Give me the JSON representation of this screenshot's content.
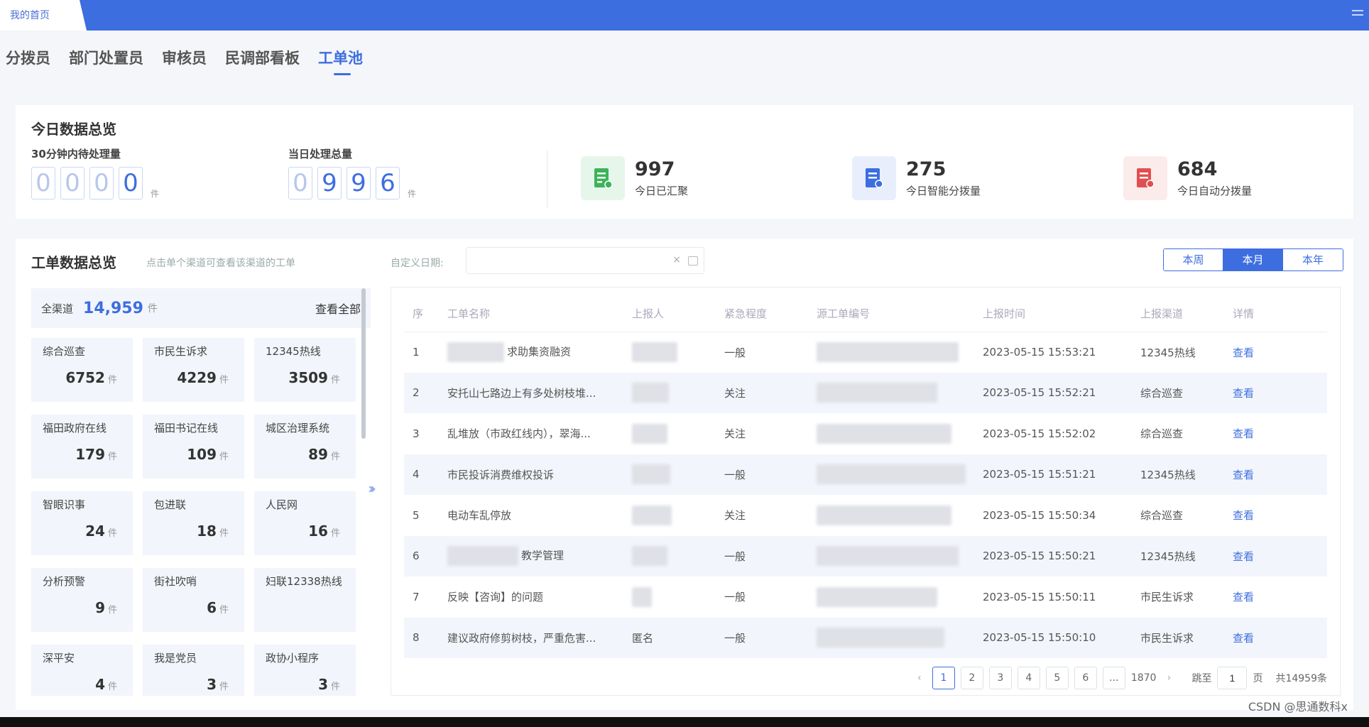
{
  "topbar": {
    "home_tab": "我的首页"
  },
  "role_tabs": [
    {
      "label": "分拨员"
    },
    {
      "label": "部门处置员"
    },
    {
      "label": "审核员"
    },
    {
      "label": "民调部看板"
    },
    {
      "label": "工单池",
      "active": true
    }
  ],
  "today": {
    "title": "今日数据总览",
    "pending30": {
      "label": "30分钟内待处理量",
      "digits": [
        "0",
        "0",
        "0",
        "0"
      ],
      "unit": "件"
    },
    "processed": {
      "label": "当日处理总量",
      "digits": [
        "0",
        "9",
        "9",
        "6"
      ],
      "unit": "件"
    },
    "stats": [
      {
        "value": "997",
        "label": "今日已汇聚",
        "color": "#3db35a",
        "bg": "#e7f6eb",
        "icon": "green-document-icon"
      },
      {
        "value": "275",
        "label": "今日智能分拨量",
        "color": "#3d6ee0",
        "bg": "#e8eefc",
        "icon": "blue-document-icon"
      },
      {
        "value": "684",
        "label": "今日自动分拨量",
        "color": "#e05050",
        "bg": "#fcebeb",
        "icon": "red-document-icon"
      }
    ]
  },
  "overview": {
    "title": "工单数据总览",
    "hint": "点击单个渠道可查看该渠道的工单",
    "date_label": "自定义日期:",
    "date_value": "",
    "clear_icon": "×",
    "periods": [
      {
        "label": "本周"
      },
      {
        "label": "本月",
        "active": true
      },
      {
        "label": "本年"
      }
    ],
    "all": {
      "label": "全渠道",
      "value": "14,959",
      "unit": "件",
      "link": "查看全部"
    },
    "channels": [
      {
        "name": "综合巡查",
        "value": "6752",
        "unit": "件"
      },
      {
        "name": "市民生诉求",
        "value": "4229",
        "unit": "件"
      },
      {
        "name": "12345热线",
        "value": "3509",
        "unit": "件"
      },
      {
        "name": "福田政府在线",
        "value": "179",
        "unit": "件"
      },
      {
        "name": "福田书记在线",
        "value": "109",
        "unit": "件"
      },
      {
        "name": "城区治理系统",
        "value": "89",
        "unit": "件"
      },
      {
        "name": "智眼识事",
        "value": "24",
        "unit": "件"
      },
      {
        "name": "包进联",
        "value": "18",
        "unit": "件"
      },
      {
        "name": "人民网",
        "value": "16",
        "unit": "件"
      },
      {
        "name": "分析预警",
        "value": "9",
        "unit": "件"
      },
      {
        "name": "街社吹哨",
        "value": "6",
        "unit": "件"
      },
      {
        "name": "妇联12338热线",
        "value": "",
        "unit": ""
      },
      {
        "name": "深平安",
        "value": "4",
        "unit": "件"
      },
      {
        "name": "我是党员",
        "value": "3",
        "unit": "件"
      },
      {
        "name": "政协小程序",
        "value": "3",
        "unit": "件"
      }
    ],
    "table": {
      "headers": [
        "序",
        "工单名称",
        "上报人",
        "紧急程度",
        "源工单编号",
        "上报时间",
        "上报渠道",
        "详情"
      ],
      "rows": [
        {
          "seq": "1",
          "name": "求助集资融资",
          "reporter": "",
          "urgency": "一般",
          "code": "",
          "time": "2023-05-15 15:53:21",
          "channel": "12345热线",
          "detail": "查看"
        },
        {
          "seq": "2",
          "name": "安托山七路边上有多处树枝堆...",
          "reporter": "",
          "urgency": "关注",
          "code": "",
          "time": "2023-05-15 15:52:21",
          "channel": "综合巡查",
          "detail": "查看"
        },
        {
          "seq": "3",
          "name": "乱堆放（市政红线内），翠海...",
          "reporter": "",
          "urgency": "关注",
          "code": "",
          "time": "2023-05-15 15:52:02",
          "channel": "综合巡查",
          "detail": "查看"
        },
        {
          "seq": "4",
          "name": "市民投诉消费维权投诉",
          "reporter": "",
          "urgency": "一般",
          "code": "",
          "time": "2023-05-15 15:51:21",
          "channel": "12345热线",
          "detail": "查看"
        },
        {
          "seq": "5",
          "name": "电动车乱停放",
          "reporter": "",
          "urgency": "关注",
          "code": "",
          "time": "2023-05-15 15:50:34",
          "channel": "综合巡查",
          "detail": "查看"
        },
        {
          "seq": "6",
          "name": "教学管理",
          "reporter": "",
          "urgency": "一般",
          "code": "",
          "time": "2023-05-15 15:50:21",
          "channel": "12345热线",
          "detail": "查看"
        },
        {
          "seq": "7",
          "name": "反映【咨询】的问题",
          "reporter": "",
          "urgency": "一般",
          "code": "",
          "time": "2023-05-15 15:50:11",
          "channel": "市民生诉求",
          "detail": "查看"
        },
        {
          "seq": "8",
          "name": "建议政府修剪树枝，严重危害...",
          "reporter": "匿名",
          "urgency": "一般",
          "code": "",
          "time": "2023-05-15 15:50:10",
          "channel": "市民生诉求",
          "detail": "查看"
        }
      ]
    },
    "pagination": {
      "prev": "‹",
      "next": "›",
      "pages": [
        "1",
        "2",
        "3",
        "4",
        "5",
        "6"
      ],
      "active": "1",
      "ellipsis": "...",
      "last": "1870",
      "goto_label": "跳至",
      "goto_value": "1",
      "goto_unit": "页",
      "total": "共14959条"
    }
  },
  "watermark": "CSDN @思通数科x"
}
